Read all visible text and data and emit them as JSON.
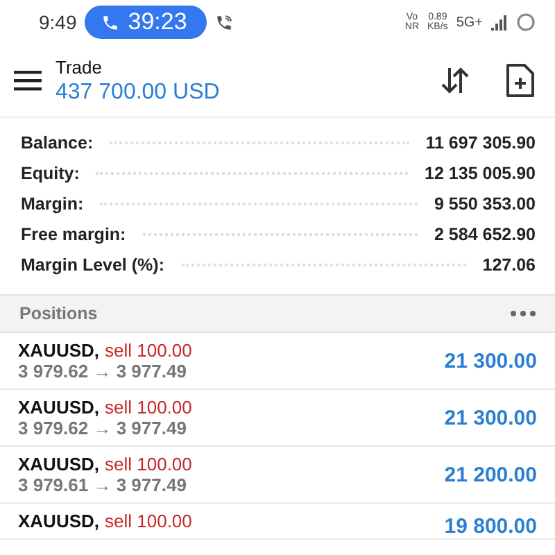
{
  "status_bar": {
    "time": "9:49",
    "call_timer": "39:23",
    "network_label": [
      "Vo",
      "NR"
    ],
    "speed": [
      "0.89",
      "KB/s"
    ],
    "network": "5G+"
  },
  "header": {
    "title": "Trade",
    "balance": "437 700.00 USD"
  },
  "summary": [
    {
      "label": "Balance:",
      "value": "11 697 305.90"
    },
    {
      "label": "Equity:",
      "value": "12 135 005.90"
    },
    {
      "label": "Margin:",
      "value": "9 550 353.00"
    },
    {
      "label": "Free margin:",
      "value": "2 584 652.90"
    },
    {
      "label": "Margin Level (%):",
      "value": "127.06"
    }
  ],
  "positions": {
    "title": "Positions",
    "rows": [
      {
        "symbol": "XAUUSD,",
        "order": "sell 100.00",
        "prices": "3 979.62 → 3 977.49",
        "profit": "21 300.00"
      },
      {
        "symbol": "XAUUSD,",
        "order": "sell 100.00",
        "prices": "3 979.62 → 3 977.49",
        "profit": "21 300.00"
      },
      {
        "symbol": "XAUUSD,",
        "order": "sell 100.00",
        "prices": "3 979.61 → 3 977.49",
        "profit": "21 200.00"
      },
      {
        "symbol": "XAUUSD,",
        "order": "sell 100.00",
        "profit": "19 800.00"
      }
    ]
  }
}
